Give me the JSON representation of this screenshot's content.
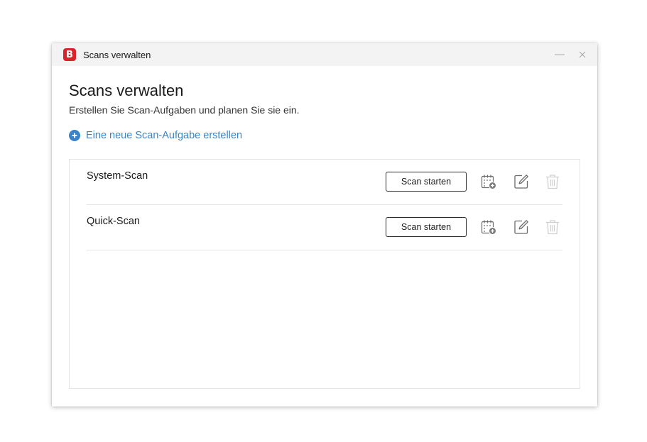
{
  "window": {
    "title": "Scans verwalten",
    "logo_letter": "B"
  },
  "page": {
    "heading": "Scans verwalten",
    "subheading": "Erstellen Sie Scan-Aufgaben und planen Sie sie ein.",
    "create_link": "Eine neue Scan-Aufgabe erstellen"
  },
  "scans": [
    {
      "name": "System-Scan",
      "start_label": "Scan starten"
    },
    {
      "name": "Quick-Scan",
      "start_label": "Scan starten"
    }
  ],
  "icons": {
    "schedule": "calendar-plus-icon",
    "edit": "edit-icon",
    "delete": "trash-icon"
  },
  "colors": {
    "brand": "#d9222a",
    "accent": "#3b82c8",
    "disabled_icon": "#d0d0d0"
  }
}
